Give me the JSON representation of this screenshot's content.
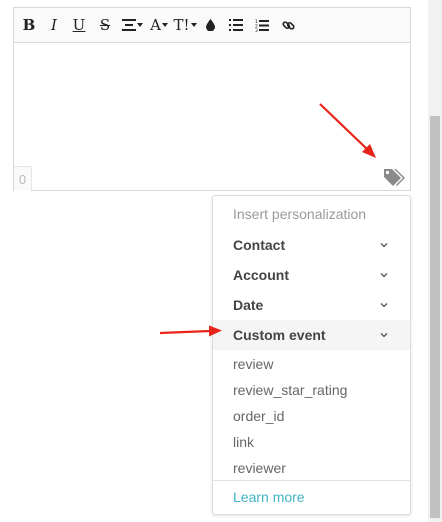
{
  "toolbar": {
    "bold": "B",
    "italic": "I",
    "underline": "U",
    "strike": "S",
    "font_color": "A",
    "text_size": "T!"
  },
  "editor": {
    "char_count": "0"
  },
  "personalization": {
    "header": "Insert personalization",
    "groups": [
      {
        "label": "Contact"
      },
      {
        "label": "Account"
      },
      {
        "label": "Date"
      },
      {
        "label": "Custom event"
      }
    ],
    "custom_event_items": [
      "review",
      "review_star_rating",
      "order_id",
      "link",
      "reviewer"
    ],
    "learn_more": "Learn more"
  },
  "colors": {
    "accent_link": "#3fb4c5",
    "annotation_arrow": "#e8231a",
    "active_row": "#f5f5f5"
  },
  "icons": {
    "tags": "tags-icon",
    "chevron": "chevron-down-icon",
    "droplet": "droplet-icon",
    "bullet_list": "bullet-list-icon",
    "numbered_list": "numbered-list-icon",
    "link": "link-icon",
    "align": "align-center-icon"
  }
}
